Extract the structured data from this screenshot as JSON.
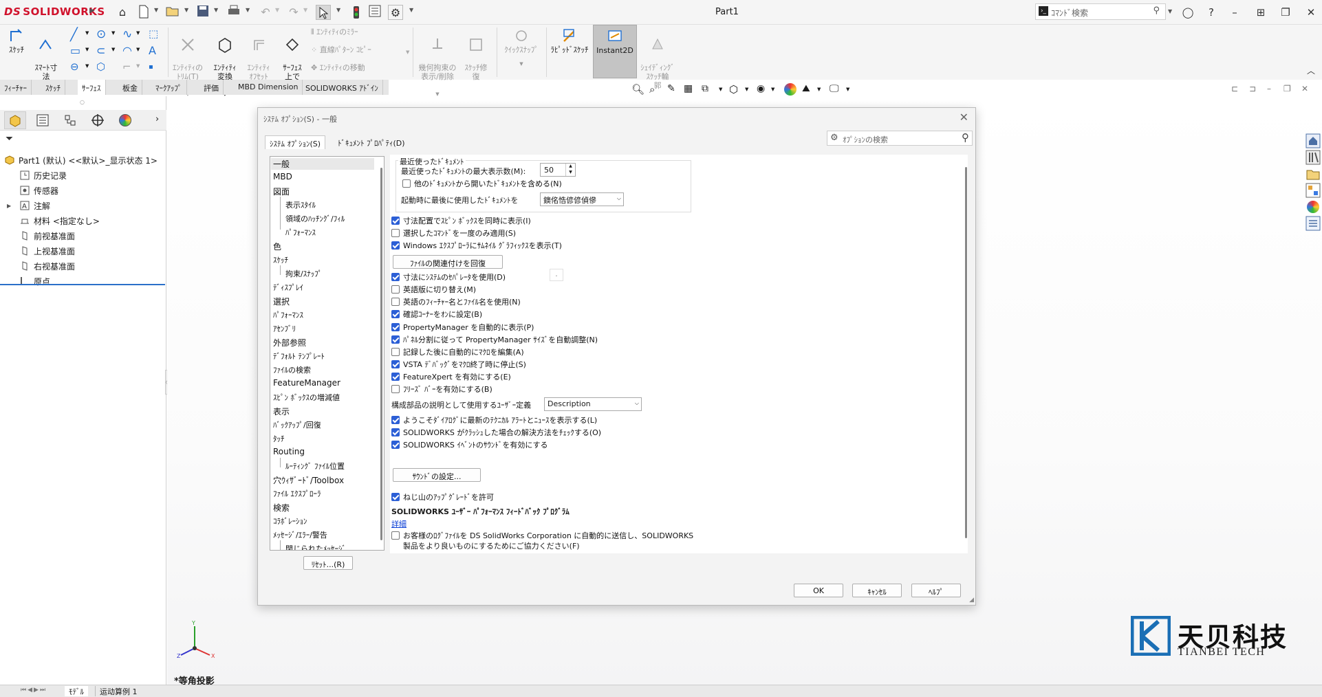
{
  "app": {
    "logo_ds": "DS",
    "logo_text": "SOLIDWORKS",
    "doc_title": "Part1",
    "command_search_placeholder": "ｺﾏﾝﾄﾞ検索",
    "brand_color": "#d0112b",
    "accent_color": "#2c5fd6"
  },
  "ribbon": {
    "sketch": "ｽｹｯﾁ",
    "smart_dim": "ｽﾏｰﾄ寸\n法",
    "trim": "ｴﾝﾃｨﾃｨの\nﾄﾘﾑ(T)",
    "convert": "ｴﾝﾃｨﾃｨ\n変換",
    "offset": "ｴﾝﾃｨﾃｨ\nｵﾌｾｯﾄ",
    "surface_offset": "ｻｰﾌｪｽ\n上で\nｵﾌｾｯﾄ",
    "mirror": "ｴﾝﾃｨﾃｨのﾐﾗｰ",
    "linear_pattern": "直線ﾊﾟﾀｰﾝ ｺﾋﾟｰ",
    "move": "ｴﾝﾃｨﾃｨの移動",
    "relations": "幾何拘束の\n表示/削除",
    "repair": "ｽｹｯﾁ修\n復",
    "quick_snap": "ｸｲｯｸｽﾅｯﾌﾟ",
    "rapid_sketch": "ﾗﾋﾟｯﾄﾞｽｹｯﾁ",
    "instant2d": "Instant2D",
    "shaded_sketch": "ｼｪｲﾃﾞｨﾝｸﾞ\nｽｹｯﾁ輪\n郭"
  },
  "tabs": [
    "ﾌｨｰﾁｬｰ",
    "ｽｹｯﾁ",
    "ｻｰﾌｪｽ",
    "板金",
    "ﾏｰｸｱｯﾌﾟ",
    "評価",
    "MBD Dimension",
    "SOLIDWORKS ｱﾄﾞｲﾝ"
  ],
  "tree": {
    "root": "Part1 (默认) <<默认>_显示状态 1>",
    "items": [
      "历史记录",
      "传感器",
      "注解",
      "材料 <指定なし>",
      "前视基准面",
      "上视基准面",
      "右视基准面",
      "原点"
    ]
  },
  "dialog": {
    "title": "ｼｽﾃﾑ ｵﾌﾟｼｮﾝ(S) - 一般",
    "search_placeholder": "ｵﾌﾟｼｮﾝの検索",
    "tab_system": "ｼｽﾃﾑ ｵﾌﾟｼｮﾝ(S)",
    "tab_document": "ﾄﾞｷｭﾒﾝﾄ ﾌﾟﾛﾊﾟﾃｨ(D)",
    "categories": [
      "一般",
      "MBD",
      "図面",
      "表示ｽﾀｲﾙ",
      "領域のﾊｯﾁﾝｸﾞ/ﾌｨﾙ",
      "ﾊﾟﾌｫｰﾏﾝｽ",
      "色",
      "ｽｹｯﾁ",
      "拘束/ｽﾅｯﾌﾟ",
      "ﾃﾞｨｽﾌﾟﾚｲ",
      "選択",
      "ﾊﾟﾌｫｰﾏﾝｽ",
      "ｱｾﾝﾌﾞﾘ",
      "外部参照",
      "ﾃﾞﾌｫﾙﾄ ﾃﾝﾌﾟﾚｰﾄ",
      "ﾌｧｲﾙの検索",
      "FeatureManager",
      "ｽﾋﾟﾝ ﾎﾞｯｸｽの増減値",
      "表示",
      "ﾊﾞｯｸｱｯﾌﾟ/回復",
      "ﾀｯﾁ",
      "Routing",
      "ﾙｰﾃｨﾝｸﾞ ﾌｧｲﾙ位置",
      "穴ｳｨｻﾞｰﾄﾞ/Toolbox",
      "ﾌｧｲﾙ ｴｸｽﾌﾟﾛｰﾗ",
      "検索",
      "ｺﾗﾎﾞﾚｰｼｮﾝ",
      "ﾒｯｾｰｼﾞ/ｴﾗｰ/警告",
      "閉じられたﾒｯｾｰｼﾞ"
    ],
    "recent_group": "最近使ったﾄﾞｷｭﾒﾝﾄ",
    "recent_max_label": "最近使ったﾄﾞｷｭﾒﾝﾄの最大表示数(M):",
    "recent_max_value": "50",
    "include_other": "他のﾄﾞｷｭﾒﾝﾄから開いたﾄﾞｷｭﾒﾝﾄを含める(N)",
    "open_last_label": "起動時に最後に使用したﾄﾞｷｭﾒﾝﾄを",
    "open_last_value": "鐭佲悎偐偐偵傪",
    "options": [
      {
        "label": "寸法配置でｽﾋﾟﾝ ﾎﾞｯｸｽを同時に表示(I)",
        "on": true
      },
      {
        "label": "選択したｺﾏﾝﾄﾞを一度のみ適用(S)",
        "on": false
      },
      {
        "label": "Windows ｴｸｽﾌﾟﾛｰﾗにｻﾑﾈｲﾙ ｸﾞﾗﾌｨｯｸｽを表示(T)",
        "on": true
      }
    ],
    "restore_assoc": "ﾌｧｲﾙの関連付けを回復",
    "options2": [
      {
        "label": "寸法にｼｽﾃﾑのｾﾊﾟﾚｰﾀを使用(D)",
        "on": true
      },
      {
        "label": "英語版に切り替え(M)",
        "on": false
      },
      {
        "label": "英語のﾌｨｰﾁｬｰ名とﾌｧｲﾙ名を使用(N)",
        "on": false
      },
      {
        "label": "確認ｺｰﾅｰをｵﾝに設定(B)",
        "on": true
      },
      {
        "label": "PropertyManager を自動的に表示(P)",
        "on": true
      },
      {
        "label": "ﾊﾟﾈﾙ分割に従って PropertyManager ｻｲｽﾞを自動調整(N)",
        "on": true
      },
      {
        "label": "記録した後に自動的にﾏｸﾛを編集(A)",
        "on": false
      },
      {
        "label": "VSTA ﾃﾞﾊﾞｯｸﾞをﾏｸﾛ終了時に停止(S)",
        "on": true
      },
      {
        "label": "FeatureXpert を有効にする(E)",
        "on": true
      },
      {
        "label": "ﾌﾘｰｽﾞ ﾊﾞｰを有効にする(B)",
        "on": false
      }
    ],
    "separator_value": ".",
    "config_desc_label": "構成部品の説明として使用するﾕｰｻﾞｰ定義",
    "config_desc_value": "Description",
    "options3": [
      {
        "label": "ようこそﾀﾞｲｱﾛｸﾞに最新のﾃｸﾆｶﾙ ｱﾗｰﾄとﾆｭｰｽを表示する(L)",
        "on": true
      },
      {
        "label": "SOLIDWORKS がｸﾗｯｼｭした場合の解決方法をﾁｪｯｸする(O)",
        "on": true
      },
      {
        "label": "SOLIDWORKS ｲﾍﾞﾝﾄのｻｳﾝﾄﾞを有効にする",
        "on": true
      }
    ],
    "sound_settings": "ｻｳﾝﾄﾞの設定...",
    "thread_upgrade": "ねじ山のｱｯﾌﾟｸﾞﾚｰﾄﾞを許可",
    "feedback_heading": "SOLIDWORKS ﾕｰｻﾞｰ ﾊﾟﾌｫｰﾏﾝｽ ﾌｨｰﾄﾞﾊﾞｯｸ ﾌﾟﾛｸﾞﾗﾑ",
    "details_link": "詳細",
    "feedback_label_1": "お客様のﾛｸﾞﾌｧｲﾙを DS SolidWorks Corporation に自動的に送信し、SOLIDWORKS",
    "feedback_label_2": "製品をより良いものにするためにご協力ください(F)",
    "reset": "ﾘｾｯﾄ...(R)",
    "ok": "OK",
    "cancel": "ｷｬﾝｾﾙ",
    "help": "ﾍﾙﾌﾟ"
  },
  "viewport": {
    "view_label": "*等角投影",
    "triad_x": "X",
    "triad_y": "Y",
    "triad_z": "Z"
  },
  "watermark": {
    "cn": "天贝科技",
    "en": "TIANBEI TECH"
  },
  "bottom": {
    "model_tab": "ﾓﾃﾞﾙ",
    "motion_tab": "运动算例 1"
  }
}
